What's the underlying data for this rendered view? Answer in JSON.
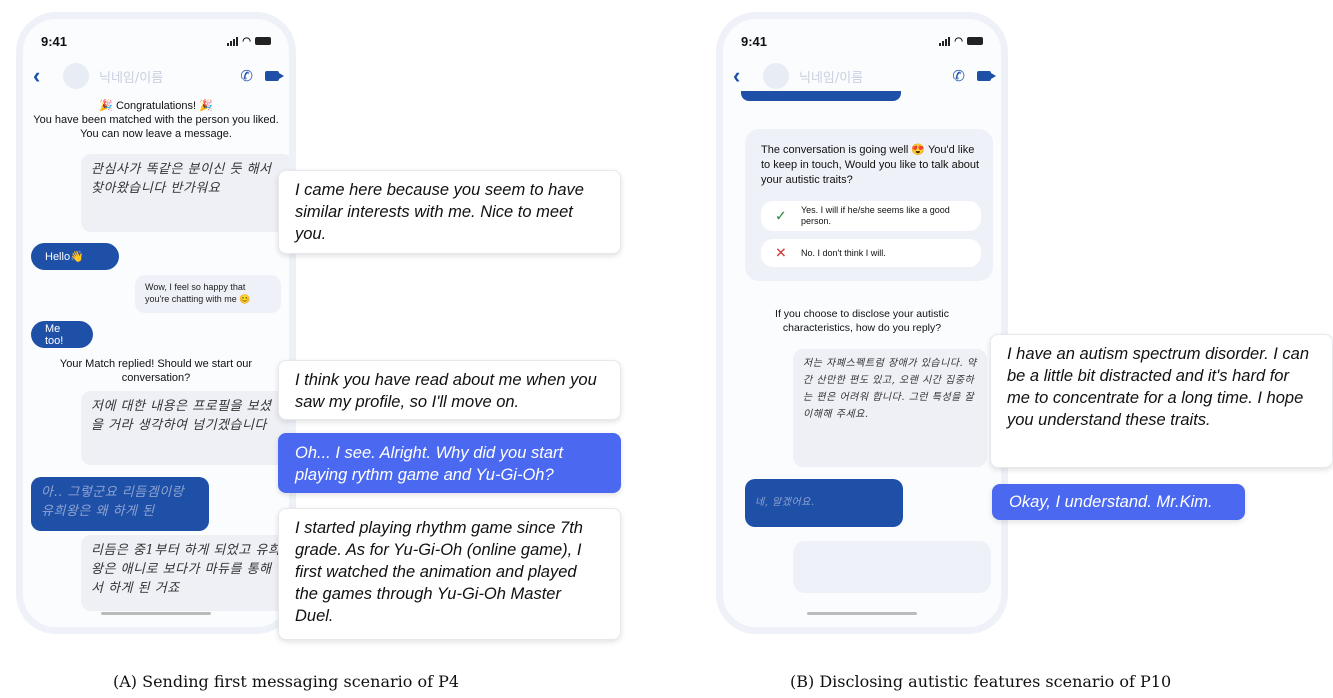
{
  "phone_a": {
    "time": "9:41",
    "nickname": "닉네임/이름",
    "congrats_title": "🎉 Congratulations! 🎉",
    "congrats_body": "You have been matched with the person you liked. You can now leave a message.",
    "hand_note_1": "관심사가 똑같은 분이신 듯 해서 찾아왔습니다 반가워요",
    "hello": "Hello👋",
    "wow": "Wow, I feel so happy that you're chatting with me 😊",
    "me_too": "Me too!",
    "match_replied": "Your Match replied! Should we start our conversation?",
    "hand_note_2": "저에 대한 내용은 프로필을 보셨을 거라 생각하여 넘기겠습니다",
    "hand_blue": "아.. 그렇군요 리듬겜이랑 유희왕은 왜 하게 된",
    "hand_note_3": "리듬은 중1부터 하게 되었고 유희왕은 애니로 보다가 마듀를 통해서 하게 된 거죠"
  },
  "phone_b": {
    "time": "9:41",
    "nickname": "닉네임/이름",
    "card_text": "The conversation is going well 😍 You'd like to keep in touch, Would you like to talk about your autistic traits?",
    "option_yes": "Yes. I will if he/she seems like a good person.",
    "option_no": "No. I don't think I will.",
    "yes_mark": "✓",
    "no_mark": "✕",
    "disclose_prompt": "If you choose to disclose your autistic characteristics, how do you reply?",
    "hand_note": "저는 자폐스펙트럼 장애가 있습니다. 약간 산만한 편도 있고, 오랜 시간 집중하는 편은 어려워 합니다. 그런 특성을 잘 이해해 주세요.",
    "hand_blue": "네, 알겠어요."
  },
  "callouts_a": [
    "I came here because you seem to have similar interests with me. Nice to meet you.",
    "I think you have read about me when you saw my profile, so I'll move on.",
    "Oh... I see. Alright. Why did you start playing rythm game and Yu-Gi-Oh?",
    "I started playing rhythm game since 7th grade. As for Yu-Gi-Oh (online game), I first watched the animation and played the games through Yu-Gi-Oh Master Duel."
  ],
  "callouts_b": [
    "I have an autism spectrum disorder. I can be a little bit distracted and it's hard for me to concentrate for a long time. I hope you understand these traits.",
    "Okay, I understand. Mr.Kim."
  ],
  "captions": {
    "a": "(A) Sending first messaging scenario of P4",
    "b": "(B) Disclosing  autistic features scenario of P10"
  },
  "colors": {
    "primary_blue": "#1e50a8",
    "callout_blue": "#4b68f0",
    "bubble_gray": "#eef1f8"
  }
}
